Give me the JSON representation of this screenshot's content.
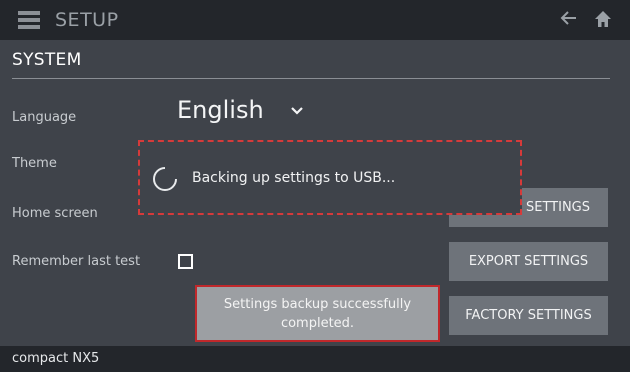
{
  "topbar": {
    "title": "SETUP",
    "menu_icon": "menu-icon",
    "back_icon": "arrow-left-icon",
    "home_icon": "home-icon"
  },
  "section": {
    "title": "SYSTEM"
  },
  "settings": {
    "language_label": "Language",
    "language_value": "English",
    "theme_label": "Theme",
    "home_screen_label": "Home screen",
    "remember_label": "Remember last test",
    "remember_checked": false
  },
  "buttons": {
    "settings_label": "SETTINGS",
    "export_label": "EXPORT SETTINGS",
    "factory_label": "FACTORY SETTINGS"
  },
  "progress": {
    "text": "Backing up settings to USB...",
    "spinner_icon": "spinner-icon"
  },
  "toast": {
    "text": "Settings backup successfully completed."
  },
  "footer": {
    "device": "compact NX5"
  },
  "colors": {
    "background": "#3f434a",
    "bar": "#23262b",
    "button": "#6e737a",
    "highlight": "#d63a3a"
  }
}
